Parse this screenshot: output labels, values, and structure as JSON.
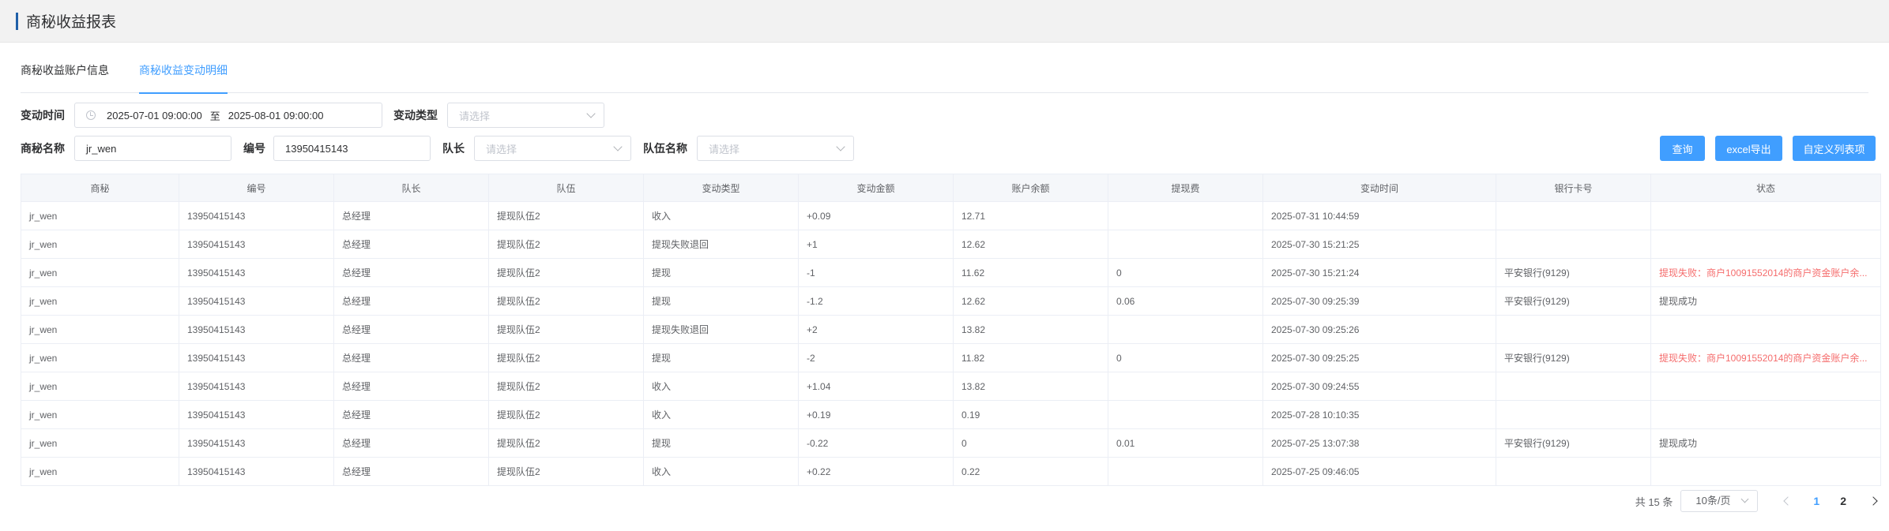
{
  "header": {
    "title": "商秘收益报表"
  },
  "tabs": [
    {
      "label": "商秘收益账户信息",
      "active": false
    },
    {
      "label": "商秘收益变动明细",
      "active": true
    }
  ],
  "filters": {
    "change_time_label": "变动时间",
    "date_start": "2025-07-01 09:00:00",
    "date_sep": "至",
    "date_end": "2025-08-01 09:00:00",
    "change_type_label": "变动类型",
    "change_type_placeholder": "请选择",
    "name_label": "商秘名称",
    "name_value": "jr_wen",
    "number_label": "编号",
    "number_value": "13950415143",
    "captain_label": "队长",
    "captain_placeholder": "请选择",
    "team_label": "队伍名称",
    "team_placeholder": "请选择"
  },
  "buttons": {
    "query": "查询",
    "export": "excel导出",
    "custom": "自定义列表项"
  },
  "accent_color": "#409eff",
  "error_color": "#f56c6c",
  "table": {
    "columns": [
      "商秘",
      "编号",
      "队长",
      "队伍",
      "变动类型",
      "变动金额",
      "账户余额",
      "提现费",
      "变动时间",
      "银行卡号",
      "状态"
    ],
    "rows": [
      [
        "jr_wen",
        "13950415143",
        "总经理",
        "提现队伍2",
        "收入",
        "+0.09",
        "12.71",
        "",
        "2025-07-31 10:44:59",
        "",
        ""
      ],
      [
        "jr_wen",
        "13950415143",
        "总经理",
        "提现队伍2",
        "提现失败退回",
        "+1",
        "12.62",
        "",
        "2025-07-30 15:21:25",
        "",
        ""
      ],
      [
        "jr_wen",
        "13950415143",
        "总经理",
        "提现队伍2",
        "提现",
        "-1",
        "11.62",
        "0",
        "2025-07-30 15:21:24",
        "平安银行(9129)",
        "提现失败：商户10091552014的商户资金账户余..."
      ],
      [
        "jr_wen",
        "13950415143",
        "总经理",
        "提现队伍2",
        "提现",
        "-1.2",
        "12.62",
        "0.06",
        "2025-07-30 09:25:39",
        "平安银行(9129)",
        "提现成功"
      ],
      [
        "jr_wen",
        "13950415143",
        "总经理",
        "提现队伍2",
        "提现失败退回",
        "+2",
        "13.82",
        "",
        "2025-07-30 09:25:26",
        "",
        ""
      ],
      [
        "jr_wen",
        "13950415143",
        "总经理",
        "提现队伍2",
        "提现",
        "-2",
        "11.82",
        "0",
        "2025-07-30 09:25:25",
        "平安银行(9129)",
        "提现失败：商户10091552014的商户资金账户余..."
      ],
      [
        "jr_wen",
        "13950415143",
        "总经理",
        "提现队伍2",
        "收入",
        "+1.04",
        "13.82",
        "",
        "2025-07-30 09:24:55",
        "",
        ""
      ],
      [
        "jr_wen",
        "13950415143",
        "总经理",
        "提现队伍2",
        "收入",
        "+0.19",
        "0.19",
        "",
        "2025-07-28 10:10:35",
        "",
        ""
      ],
      [
        "jr_wen",
        "13950415143",
        "总经理",
        "提现队伍2",
        "提现",
        "-0.22",
        "0",
        "0.01",
        "2025-07-25 13:07:38",
        "平安银行(9129)",
        "提现成功"
      ],
      [
        "jr_wen",
        "13950415143",
        "总经理",
        "提现队伍2",
        "收入",
        "+0.22",
        "0.22",
        "",
        "2025-07-25 09:46:05",
        "",
        ""
      ]
    ]
  },
  "pagination": {
    "total": "共 15 条",
    "page_size": "10条/页",
    "pages": [
      "1",
      "2"
    ],
    "current": "1"
  }
}
